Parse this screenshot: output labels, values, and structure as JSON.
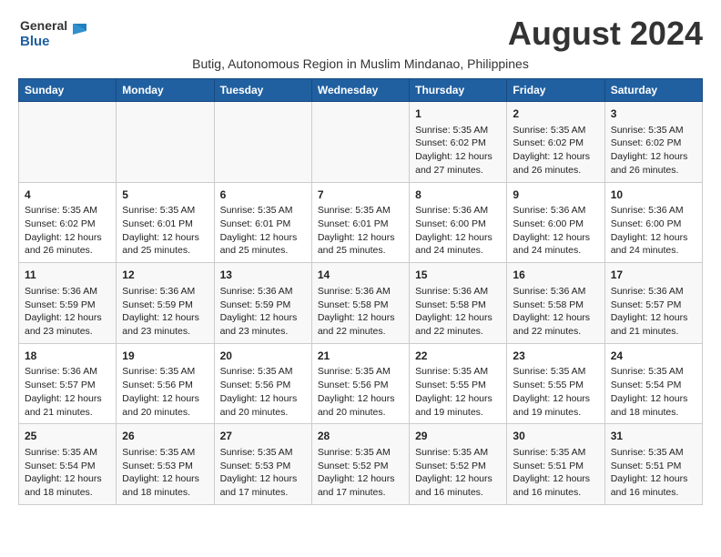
{
  "header": {
    "logo_line1": "General",
    "logo_line2": "Blue",
    "month_title": "August 2024",
    "subtitle": "Butig, Autonomous Region in Muslim Mindanao, Philippines"
  },
  "weekdays": [
    "Sunday",
    "Monday",
    "Tuesday",
    "Wednesday",
    "Thursday",
    "Friday",
    "Saturday"
  ],
  "weeks": [
    [
      {
        "day": "",
        "text": ""
      },
      {
        "day": "",
        "text": ""
      },
      {
        "day": "",
        "text": ""
      },
      {
        "day": "",
        "text": ""
      },
      {
        "day": "1",
        "text": "Sunrise: 5:35 AM\nSunset: 6:02 PM\nDaylight: 12 hours and 27 minutes."
      },
      {
        "day": "2",
        "text": "Sunrise: 5:35 AM\nSunset: 6:02 PM\nDaylight: 12 hours and 26 minutes."
      },
      {
        "day": "3",
        "text": "Sunrise: 5:35 AM\nSunset: 6:02 PM\nDaylight: 12 hours and 26 minutes."
      }
    ],
    [
      {
        "day": "4",
        "text": "Sunrise: 5:35 AM\nSunset: 6:02 PM\nDaylight: 12 hours and 26 minutes."
      },
      {
        "day": "5",
        "text": "Sunrise: 5:35 AM\nSunset: 6:01 PM\nDaylight: 12 hours and 25 minutes."
      },
      {
        "day": "6",
        "text": "Sunrise: 5:35 AM\nSunset: 6:01 PM\nDaylight: 12 hours and 25 minutes."
      },
      {
        "day": "7",
        "text": "Sunrise: 5:35 AM\nSunset: 6:01 PM\nDaylight: 12 hours and 25 minutes."
      },
      {
        "day": "8",
        "text": "Sunrise: 5:36 AM\nSunset: 6:00 PM\nDaylight: 12 hours and 24 minutes."
      },
      {
        "day": "9",
        "text": "Sunrise: 5:36 AM\nSunset: 6:00 PM\nDaylight: 12 hours and 24 minutes."
      },
      {
        "day": "10",
        "text": "Sunrise: 5:36 AM\nSunset: 6:00 PM\nDaylight: 12 hours and 24 minutes."
      }
    ],
    [
      {
        "day": "11",
        "text": "Sunrise: 5:36 AM\nSunset: 5:59 PM\nDaylight: 12 hours and 23 minutes."
      },
      {
        "day": "12",
        "text": "Sunrise: 5:36 AM\nSunset: 5:59 PM\nDaylight: 12 hours and 23 minutes."
      },
      {
        "day": "13",
        "text": "Sunrise: 5:36 AM\nSunset: 5:59 PM\nDaylight: 12 hours and 23 minutes."
      },
      {
        "day": "14",
        "text": "Sunrise: 5:36 AM\nSunset: 5:58 PM\nDaylight: 12 hours and 22 minutes."
      },
      {
        "day": "15",
        "text": "Sunrise: 5:36 AM\nSunset: 5:58 PM\nDaylight: 12 hours and 22 minutes."
      },
      {
        "day": "16",
        "text": "Sunrise: 5:36 AM\nSunset: 5:58 PM\nDaylight: 12 hours and 22 minutes."
      },
      {
        "day": "17",
        "text": "Sunrise: 5:36 AM\nSunset: 5:57 PM\nDaylight: 12 hours and 21 minutes."
      }
    ],
    [
      {
        "day": "18",
        "text": "Sunrise: 5:36 AM\nSunset: 5:57 PM\nDaylight: 12 hours and 21 minutes."
      },
      {
        "day": "19",
        "text": "Sunrise: 5:35 AM\nSunset: 5:56 PM\nDaylight: 12 hours and 20 minutes."
      },
      {
        "day": "20",
        "text": "Sunrise: 5:35 AM\nSunset: 5:56 PM\nDaylight: 12 hours and 20 minutes."
      },
      {
        "day": "21",
        "text": "Sunrise: 5:35 AM\nSunset: 5:56 PM\nDaylight: 12 hours and 20 minutes."
      },
      {
        "day": "22",
        "text": "Sunrise: 5:35 AM\nSunset: 5:55 PM\nDaylight: 12 hours and 19 minutes."
      },
      {
        "day": "23",
        "text": "Sunrise: 5:35 AM\nSunset: 5:55 PM\nDaylight: 12 hours and 19 minutes."
      },
      {
        "day": "24",
        "text": "Sunrise: 5:35 AM\nSunset: 5:54 PM\nDaylight: 12 hours and 18 minutes."
      }
    ],
    [
      {
        "day": "25",
        "text": "Sunrise: 5:35 AM\nSunset: 5:54 PM\nDaylight: 12 hours and 18 minutes."
      },
      {
        "day": "26",
        "text": "Sunrise: 5:35 AM\nSunset: 5:53 PM\nDaylight: 12 hours and 18 minutes."
      },
      {
        "day": "27",
        "text": "Sunrise: 5:35 AM\nSunset: 5:53 PM\nDaylight: 12 hours and 17 minutes."
      },
      {
        "day": "28",
        "text": "Sunrise: 5:35 AM\nSunset: 5:52 PM\nDaylight: 12 hours and 17 minutes."
      },
      {
        "day": "29",
        "text": "Sunrise: 5:35 AM\nSunset: 5:52 PM\nDaylight: 12 hours and 16 minutes."
      },
      {
        "day": "30",
        "text": "Sunrise: 5:35 AM\nSunset: 5:51 PM\nDaylight: 12 hours and 16 minutes."
      },
      {
        "day": "31",
        "text": "Sunrise: 5:35 AM\nSunset: 5:51 PM\nDaylight: 12 hours and 16 minutes."
      }
    ]
  ]
}
